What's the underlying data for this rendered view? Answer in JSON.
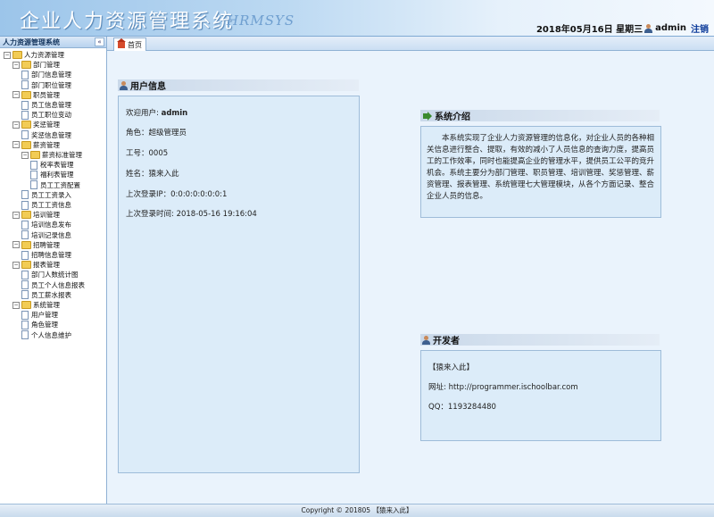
{
  "header": {
    "title": "企业人力资源管理系统",
    "subtitle": "HRMSYS",
    "date_text": "2018年05月16日 星期三",
    "username": "admin",
    "logout_label": "注销"
  },
  "sidebar": {
    "title": "人力资源管理系统",
    "collapse_label": "«",
    "tree": [
      {
        "label": "人力资源管理",
        "level": 0,
        "type": "folder"
      },
      {
        "label": "部门管理",
        "level": 1,
        "type": "folder"
      },
      {
        "label": "部门信息管理",
        "level": 2,
        "type": "doc"
      },
      {
        "label": "部门职位管理",
        "level": 2,
        "type": "doc"
      },
      {
        "label": "职员管理",
        "level": 1,
        "type": "folder"
      },
      {
        "label": "员工信息管理",
        "level": 2,
        "type": "doc"
      },
      {
        "label": "员工职位变动",
        "level": 2,
        "type": "doc"
      },
      {
        "label": "奖惩管理",
        "level": 1,
        "type": "folder"
      },
      {
        "label": "奖惩信息管理",
        "level": 2,
        "type": "doc"
      },
      {
        "label": "薪资管理",
        "level": 1,
        "type": "folder"
      },
      {
        "label": "薪资标准管理",
        "level": 2,
        "type": "folder"
      },
      {
        "label": "税率表管理",
        "level": 3,
        "type": "doc"
      },
      {
        "label": "福利表管理",
        "level": 3,
        "type": "doc"
      },
      {
        "label": "员工工资配置",
        "level": 3,
        "type": "doc"
      },
      {
        "label": "员工工资录入",
        "level": 2,
        "type": "doc"
      },
      {
        "label": "员工工资信息",
        "level": 2,
        "type": "doc"
      },
      {
        "label": "培训管理",
        "level": 1,
        "type": "folder"
      },
      {
        "label": "培训信息发布",
        "level": 2,
        "type": "doc"
      },
      {
        "label": "培训记录信息",
        "level": 2,
        "type": "doc"
      },
      {
        "label": "招聘管理",
        "level": 1,
        "type": "folder"
      },
      {
        "label": "招聘信息管理",
        "level": 2,
        "type": "doc"
      },
      {
        "label": "报表管理",
        "level": 1,
        "type": "folder"
      },
      {
        "label": "部门人数统计图",
        "level": 2,
        "type": "doc"
      },
      {
        "label": "员工个人信息报表",
        "level": 2,
        "type": "doc"
      },
      {
        "label": "员工薪水报表",
        "level": 2,
        "type": "doc"
      },
      {
        "label": "系统管理",
        "level": 1,
        "type": "folder"
      },
      {
        "label": "用户管理",
        "level": 2,
        "type": "doc"
      },
      {
        "label": "角色管理",
        "level": 2,
        "type": "doc"
      },
      {
        "label": "个人信息维护",
        "level": 2,
        "type": "doc"
      }
    ]
  },
  "tabs": [
    {
      "label": "首页"
    }
  ],
  "user_info": {
    "title": "用户信息",
    "welcome_label": "欢迎用户:",
    "welcome_value": "admin",
    "role_text": "角色：超级管理员",
    "id_text": "工号：0005",
    "name_text": "姓名：猿来入此",
    "last_ip_text": "上次登录IP：0:0:0:0:0:0:0:1",
    "last_time_text": "上次登录时间: 2018-05-16 19:16:04"
  },
  "system_intro": {
    "title": "系统介绍",
    "text": "本系统实现了企业人力资源管理的信息化，对企业人员的各种相关信息进行整合、提取，有效的减小了人员信息的查询力度，提高员工的工作效率，同时也能提高企业的管理水平，提供员工公平的竞升机会。系统主要分为部门管理、职员管理、培训管理、奖惩管理、薪资管理、报表管理、系统管理七大管理模块，从各个方面记录、整合企业人员的信息。"
  },
  "developer": {
    "title": "开发者",
    "name": "【猿来入此】",
    "url_text": "网址: http://programmer.ischoolbar.com",
    "qq_text": "QQ：1193284480"
  },
  "footer": {
    "text": "Copyright © 201805 【猿来入此】"
  }
}
